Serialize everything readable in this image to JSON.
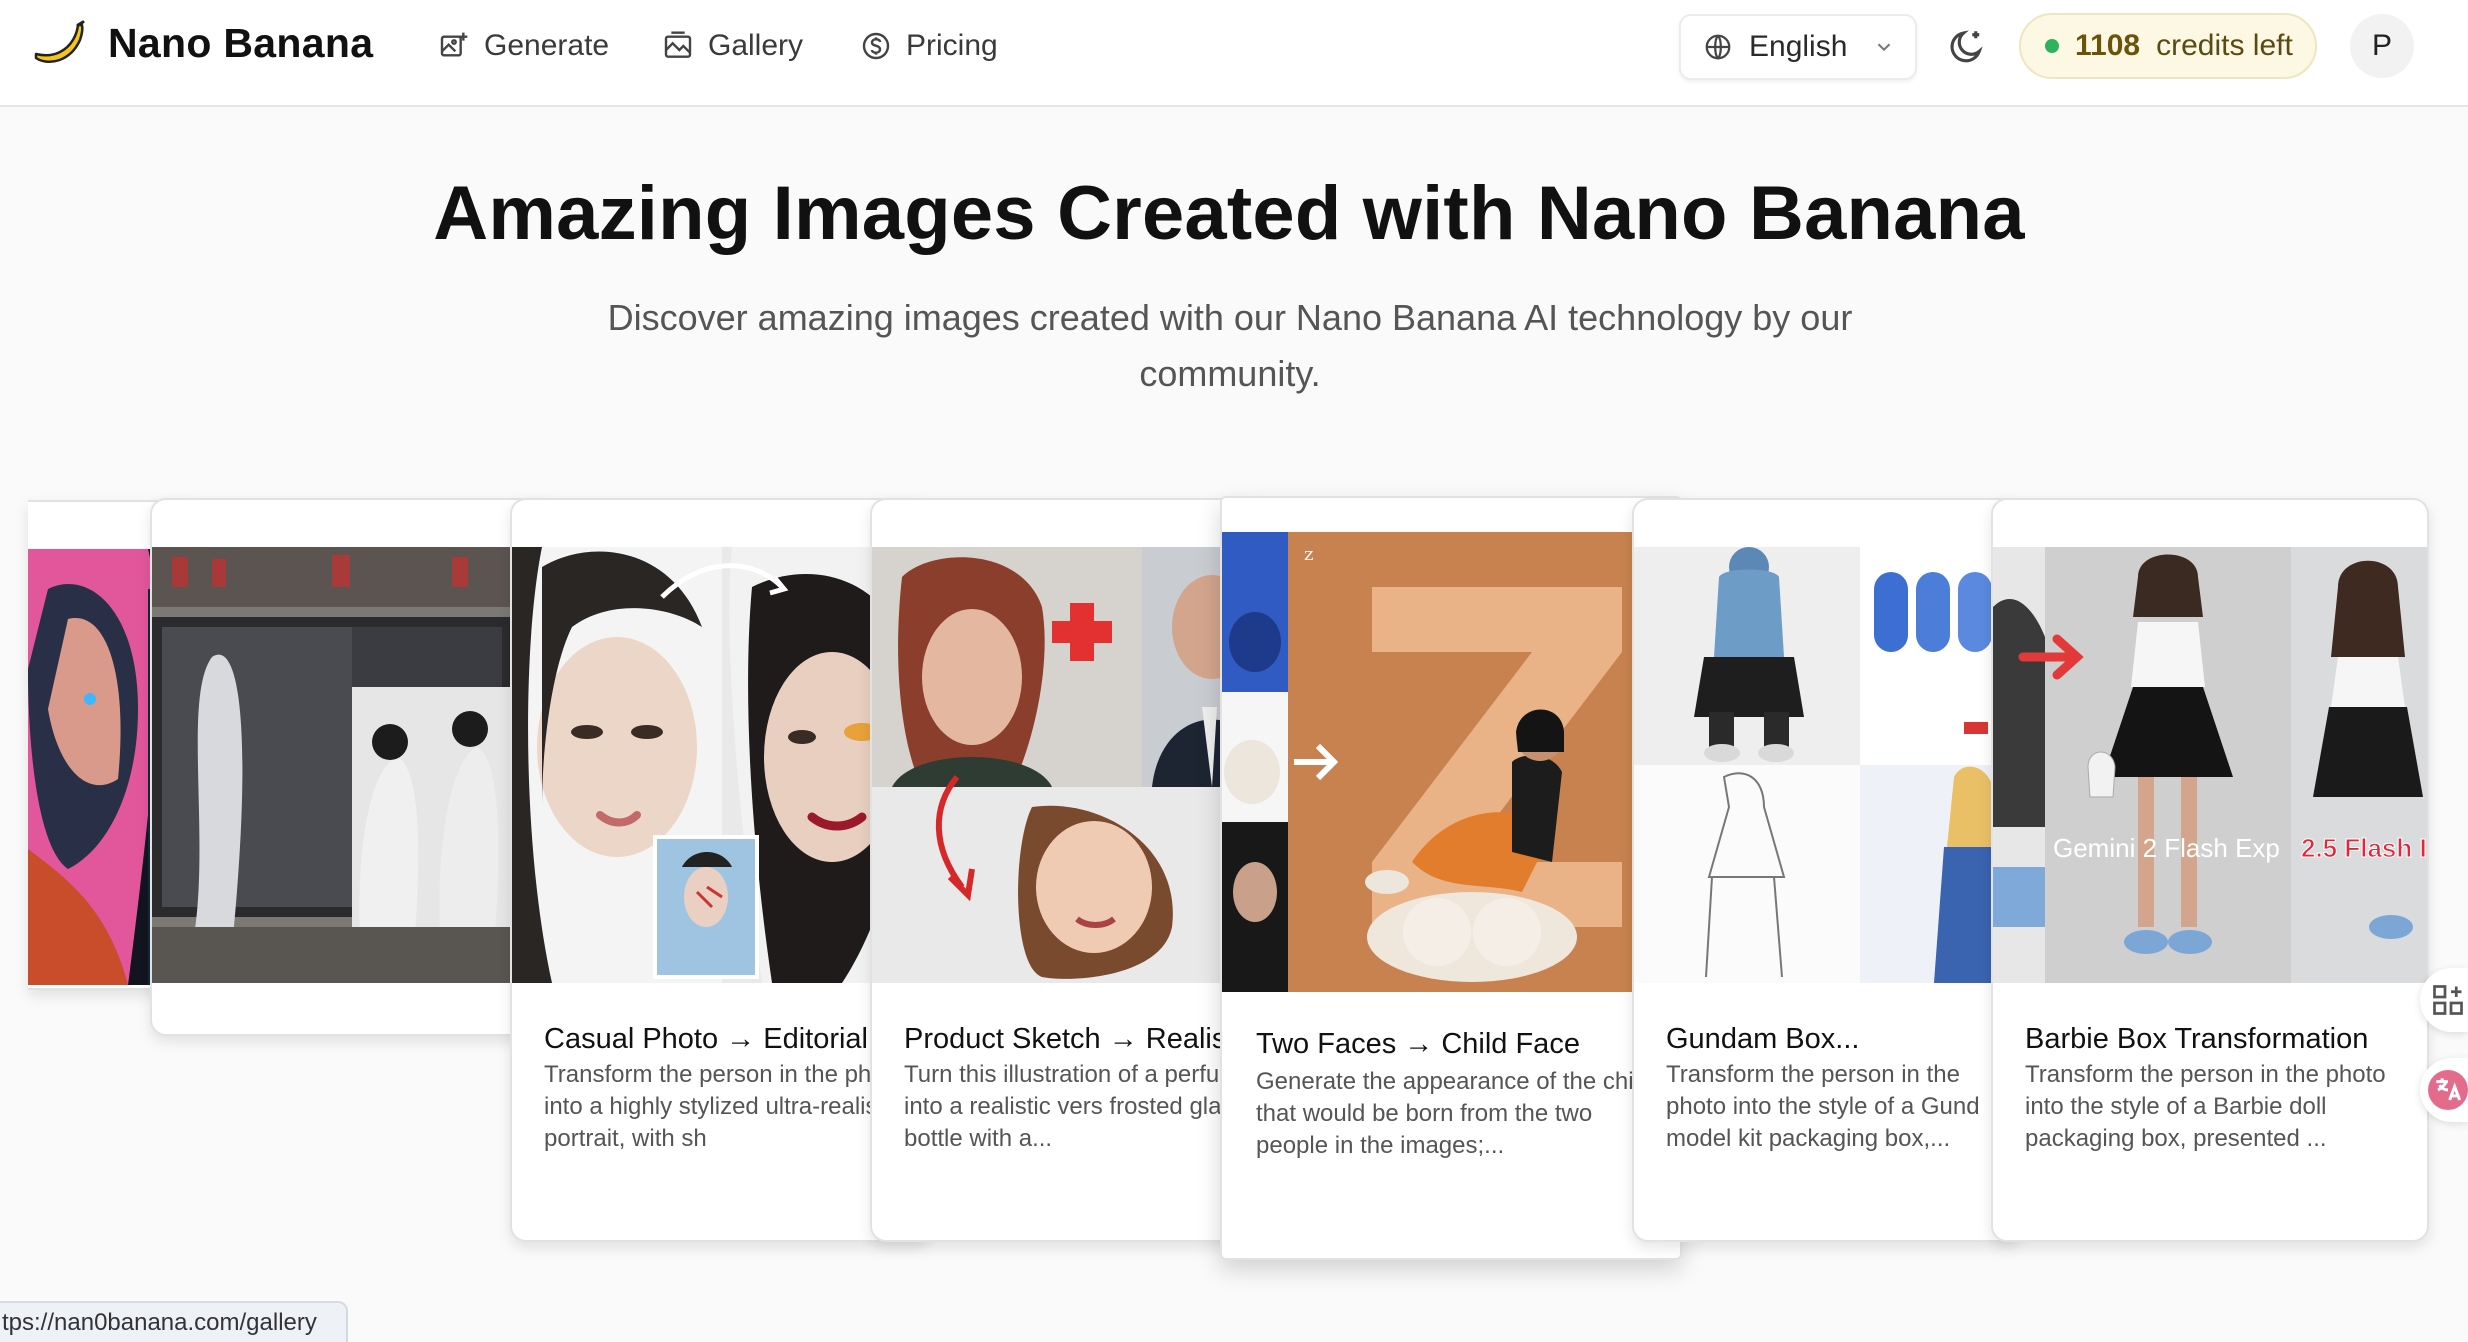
{
  "header": {
    "brand": "Nano Banana",
    "nav": [
      {
        "label": "Generate",
        "icon": "image-plus-icon"
      },
      {
        "label": "Gallery",
        "icon": "gallery-icon"
      },
      {
        "label": "Pricing",
        "icon": "dollar-circle-icon"
      }
    ],
    "language": "English",
    "credits_count": "1108",
    "credits_text": "credits left",
    "avatar_initial": "P"
  },
  "hero": {
    "title": "Amazing Images Created with Nano Banana",
    "subtitle": "Discover amazing images created with our Nano Banana AI technology by our community."
  },
  "cards": [
    {
      "title": "Casual Photo → Editorial",
      "description": "Transform the person in the photo into a highly stylized ultra-realistic portrait, with sh"
    },
    {
      "title": "Product Sketch → Realis",
      "description": "Turn this illustration of a perfume into a realistic vers frosted glass bottle with a..."
    },
    {
      "title": "Two Faces → Child Face",
      "description": "Generate the appearance of the child that would be born from the two people in the images;..."
    },
    {
      "title": "Gundam Box...",
      "description": "Transform the person in the photo into the style of a Gund model kit packaging box,..."
    },
    {
      "title": "Barbie Box Transformation",
      "description": "Transform the person in the photo into the style of a Barbie doll packaging box, presented ..."
    }
  ],
  "image_labels": {
    "gemini": "Gemini 2 Flash Exp",
    "flash": "2.5 Flash I"
  },
  "status_url": "tps://nan0banana.com/gallery",
  "colors": {
    "accent_dot": "#2fb25c",
    "credits_bg": "#fcf8e4"
  }
}
